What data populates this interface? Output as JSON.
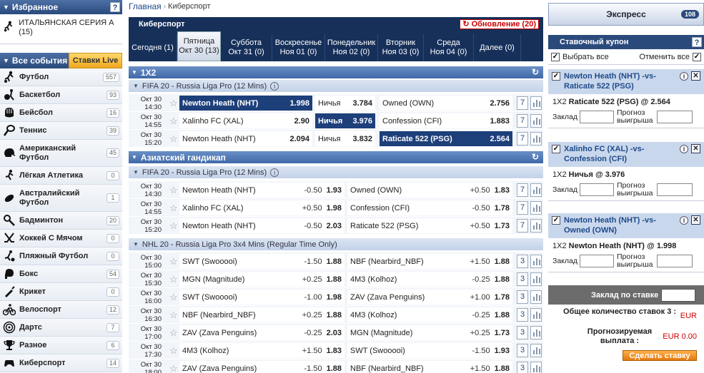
{
  "left": {
    "favorites_title": "Избранное",
    "help": "?",
    "favorite_item": "ИТАЛЬЯНСКАЯ СЕРИЯ А (15)",
    "all_events": "Все события",
    "live_bets": "Ставки Live",
    "sports": [
      {
        "name": "Футбол",
        "count": "557",
        "icon": "soccer-player-icon"
      },
      {
        "name": "Баскетбол",
        "count": "93",
        "icon": "basketball-icon"
      },
      {
        "name": "Бейсбол",
        "count": "16",
        "icon": "baseball-glove-icon"
      },
      {
        "name": "Теннис",
        "count": "39",
        "icon": "tennis-racket-icon"
      },
      {
        "name": "Американский Футбол",
        "count": "45",
        "icon": "football-helmet-icon"
      },
      {
        "name": "Лёгкая Атлетика",
        "count": "0",
        "icon": "runner-icon"
      },
      {
        "name": "Австралийский Футбол",
        "count": "1",
        "icon": "rugby-ball-icon"
      },
      {
        "name": "Бадминтон",
        "count": "20",
        "icon": "badminton-racket-icon"
      },
      {
        "name": "Хоккей С Мячом",
        "count": "0",
        "icon": "hockey-sticks-icon"
      },
      {
        "name": "Пляжный Футбол",
        "count": "0",
        "icon": "beach-soccer-icon"
      },
      {
        "name": "Бокс",
        "count": "54",
        "icon": "boxing-glove-icon"
      },
      {
        "name": "Крикет",
        "count": "0",
        "icon": "cricket-bat-icon"
      },
      {
        "name": "Велоспорт",
        "count": "12",
        "icon": "cyclist-icon"
      },
      {
        "name": "Дартс",
        "count": "7",
        "icon": "dartboard-icon"
      },
      {
        "name": "Разное",
        "count": "6",
        "icon": "trophy-icon"
      },
      {
        "name": "Киберспорт",
        "count": "14",
        "icon": "esports-controller-icon"
      }
    ]
  },
  "breadcrumb": {
    "home": "Главная",
    "sep": "›",
    "current": "Киберспорт"
  },
  "panel": {
    "title": "Киберспорт",
    "refresh": "Обновление (20)",
    "days": [
      {
        "l1": "Сегодня (1)",
        "l2": ""
      },
      {
        "l1": "Пятница",
        "l2": "Окт 30 (13)"
      },
      {
        "l1": "Суббота",
        "l2": "Окт 31 (0)"
      },
      {
        "l1": "Воскресенье",
        "l2": "Ноя 01 (0)"
      },
      {
        "l1": "Понедельник",
        "l2": "Ноя 02 (0)"
      },
      {
        "l1": "Вторник",
        "l2": "Ноя 03 (0)"
      },
      {
        "l1": "Среда",
        "l2": "Ноя 04 (0)"
      },
      {
        "l1": "Далее (0)",
        "l2": ""
      }
    ]
  },
  "section1": {
    "title": "1X2",
    "league": "FIFA 20 - Russia Liga Pro (12 Mins)",
    "rows": [
      {
        "date": "Окт 30",
        "time": "14:30",
        "home": "Newton Heath (NHT)",
        "home_odd": "1.998",
        "draw": "Ничья",
        "draw_odd": "3.784",
        "away": "Owned (OWN)",
        "away_odd": "2.756",
        "markets": "7"
      },
      {
        "date": "Окт 30",
        "time": "14:55",
        "home": "Xalinho FC (XAL)",
        "home_odd": "2.90",
        "draw": "Ничья",
        "draw_odd": "3.976",
        "away": "Confession (CFI)",
        "away_odd": "1.883",
        "markets": "7"
      },
      {
        "date": "Окт 30",
        "time": "15:20",
        "home": "Newton Heath (NHT)",
        "home_odd": "2.094",
        "draw": "Ничья",
        "draw_odd": "3.832",
        "away": "Raticate 522 (PSG)",
        "away_odd": "2.564",
        "markets": "7"
      }
    ]
  },
  "section2": {
    "title": "Азиатский гандикап",
    "league1": "FIFA 20 - Russia Liga Pro (12 Mins)",
    "rows1": [
      {
        "date": "Окт 30",
        "time": "14:30",
        "home": "Newton Heath (NHT)",
        "hh": "-0.50",
        "ho": "1.93",
        "away": "Owned (OWN)",
        "ah": "+0.50",
        "ao": "1.83",
        "markets": "7"
      },
      {
        "date": "Окт 30",
        "time": "14:55",
        "home": "Xalinho FC (XAL)",
        "hh": "+0.50",
        "ho": "1.98",
        "away": "Confession (CFI)",
        "ah": "-0.50",
        "ao": "1.78",
        "markets": "7"
      },
      {
        "date": "Окт 30",
        "time": "15:20",
        "home": "Newton Heath (NHT)",
        "hh": "-0.50",
        "ho": "2.03",
        "away": "Raticate 522 (PSG)",
        "ah": "+0.50",
        "ao": "1.73",
        "markets": "7"
      }
    ],
    "league2": "NHL 20 - Russia Liga Pro 3x4 Mins (Regular Time Only)",
    "rows2": [
      {
        "date": "Окт 30",
        "time": "15:00",
        "home": "SWT (Swooooi)",
        "hh": "-1.50",
        "ho": "1.88",
        "away": "NBF (Nearbird_NBF)",
        "ah": "+1.50",
        "ao": "1.88",
        "markets": "3"
      },
      {
        "date": "Окт 30",
        "time": "15:30",
        "home": "MGN (Magnitude)",
        "hh": "+0.25",
        "ho": "1.88",
        "away": "4M3 (Kolhoz)",
        "ah": "-0.25",
        "ao": "1.88",
        "markets": "3"
      },
      {
        "date": "Окт 30",
        "time": "16:00",
        "home": "SWT (Swooooi)",
        "hh": "-1.00",
        "ho": "1.98",
        "away": "ZAV (Zava Penguins)",
        "ah": "+1.00",
        "ao": "1.78",
        "markets": "3"
      },
      {
        "date": "Окт 30",
        "time": "16:30",
        "home": "NBF (Nearbird_NBF)",
        "hh": "+0.25",
        "ho": "1.88",
        "away": "4M3 (Kolhoz)",
        "ah": "-0.25",
        "ao": "1.88",
        "markets": "3"
      },
      {
        "date": "Окт 30",
        "time": "17:00",
        "home": "ZAV (Zava Penguins)",
        "hh": "-0.25",
        "ho": "2.03",
        "away": "MGN (Magnitude)",
        "ah": "+0.25",
        "ao": "1.73",
        "markets": "3"
      },
      {
        "date": "Окт 30",
        "time": "17:30",
        "home": "4M3 (Kolhoz)",
        "hh": "+1.50",
        "ho": "1.83",
        "away": "SWT (Swooooi)",
        "ah": "-1.50",
        "ao": "1.93",
        "markets": "3"
      },
      {
        "date": "Окт 30",
        "time": "18:00",
        "home": "ZAV (Zava Penguins)",
        "hh": "-1.50",
        "ho": "1.88",
        "away": "NBF (Nearbird_NBF)",
        "ah": "+1.50",
        "ao": "1.88",
        "markets": "3"
      }
    ]
  },
  "right": {
    "express": "Экспресс",
    "express_count": "108",
    "coupon_title": "Ставочный купон",
    "help": "?",
    "select_all": "Выбрать все",
    "cancel_all": "Отменить все",
    "bets": [
      {
        "match": "Newton Heath (NHT) -vs- Raticate 522 (PSG)",
        "market": "1X2",
        "pick": "Raticate 522 (PSG)",
        "odd": "@ 2.564"
      },
      {
        "match": "Xalinho FC (XAL) -vs- Confession (CFI)",
        "market": "1X2",
        "pick": "Ничья",
        "odd": "@ 3.976"
      },
      {
        "match": "Newton Heath (NHT) -vs- Owned (OWN)",
        "market": "1X2",
        "pick": "Newton Heath (NHT)",
        "odd": "@ 1.998"
      }
    ],
    "stake_label": "Заклад",
    "payout_label": "Прогноз выигрыша",
    "stake_per_bet": "Заклад по ставке",
    "total_label": "Общее количество ставок 3 :",
    "total_value": "EUR",
    "payout_total_label": "Прогнозируемая выплата :",
    "payout_total_value": "EUR 0.00",
    "make_bet": "Сделать ставку"
  }
}
